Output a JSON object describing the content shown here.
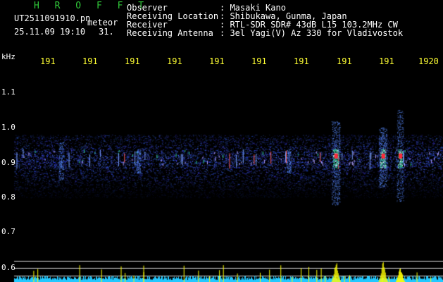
{
  "header": {
    "brand": "H R O F F T",
    "file_name": "UT2511091910.pn",
    "tag": "meteor",
    "datetime": "25.11.09 19:10",
    "index": "31.",
    "info_rows": [
      {
        "label": "Observer",
        "value": ": Masaki Kano"
      },
      {
        "label": "Receiving Location",
        "value": ": Shibukawa, Gunma, Japan"
      },
      {
        "label": "Receiver",
        "value": ": RTL-SDR SDR# 43dB L15 103.2MHz CW"
      },
      {
        "label": "Receiving Antenna",
        "value": ": 3el Yagi(V) Az 330 for Vladivostok"
      }
    ]
  },
  "chart_data": {
    "type": "heatmap",
    "ylabel": "kHz",
    "y_ticks": [
      "1.1",
      "1.0",
      "0.9",
      "0.8",
      "0.7",
      "0.6"
    ],
    "x_ticks": [
      "191",
      "191",
      "191",
      "191",
      "191",
      "191",
      "191",
      "191",
      "191",
      "1920"
    ],
    "ylim": [
      0.6,
      1.15
    ],
    "x_range_minutes": [
      1910,
      1920
    ],
    "noise_band_khz": [
      0.8,
      0.98
    ],
    "carrier_khz": 0.91,
    "echo_events": [
      {
        "minute": 1917.5,
        "strength": 1.0,
        "spread_khz": [
          0.78,
          1.02
        ]
      },
      {
        "minute": 1918.6,
        "strength": 0.95,
        "spread_khz": [
          0.83,
          1.0
        ]
      },
      {
        "minute": 1919.0,
        "strength": 0.7,
        "spread_khz": [
          0.79,
          1.05
        ]
      },
      {
        "minute": 1911.1,
        "strength": 0.35,
        "spread_khz": [
          0.85,
          0.96
        ]
      },
      {
        "minute": 1912.9,
        "strength": 0.3,
        "spread_khz": [
          0.87,
          0.94
        ]
      },
      {
        "minute": 1916.4,
        "strength": 0.3,
        "spread_khz": [
          0.87,
          0.94
        ]
      }
    ],
    "colors": {
      "background": "#000000",
      "noise": "#1a2a9a",
      "echo_low": "#2fd08a",
      "echo_high": "#ff2a3a",
      "carrier": "#ff6060",
      "trace": "#22c8ff",
      "trace_peak": "#ffff00"
    }
  }
}
